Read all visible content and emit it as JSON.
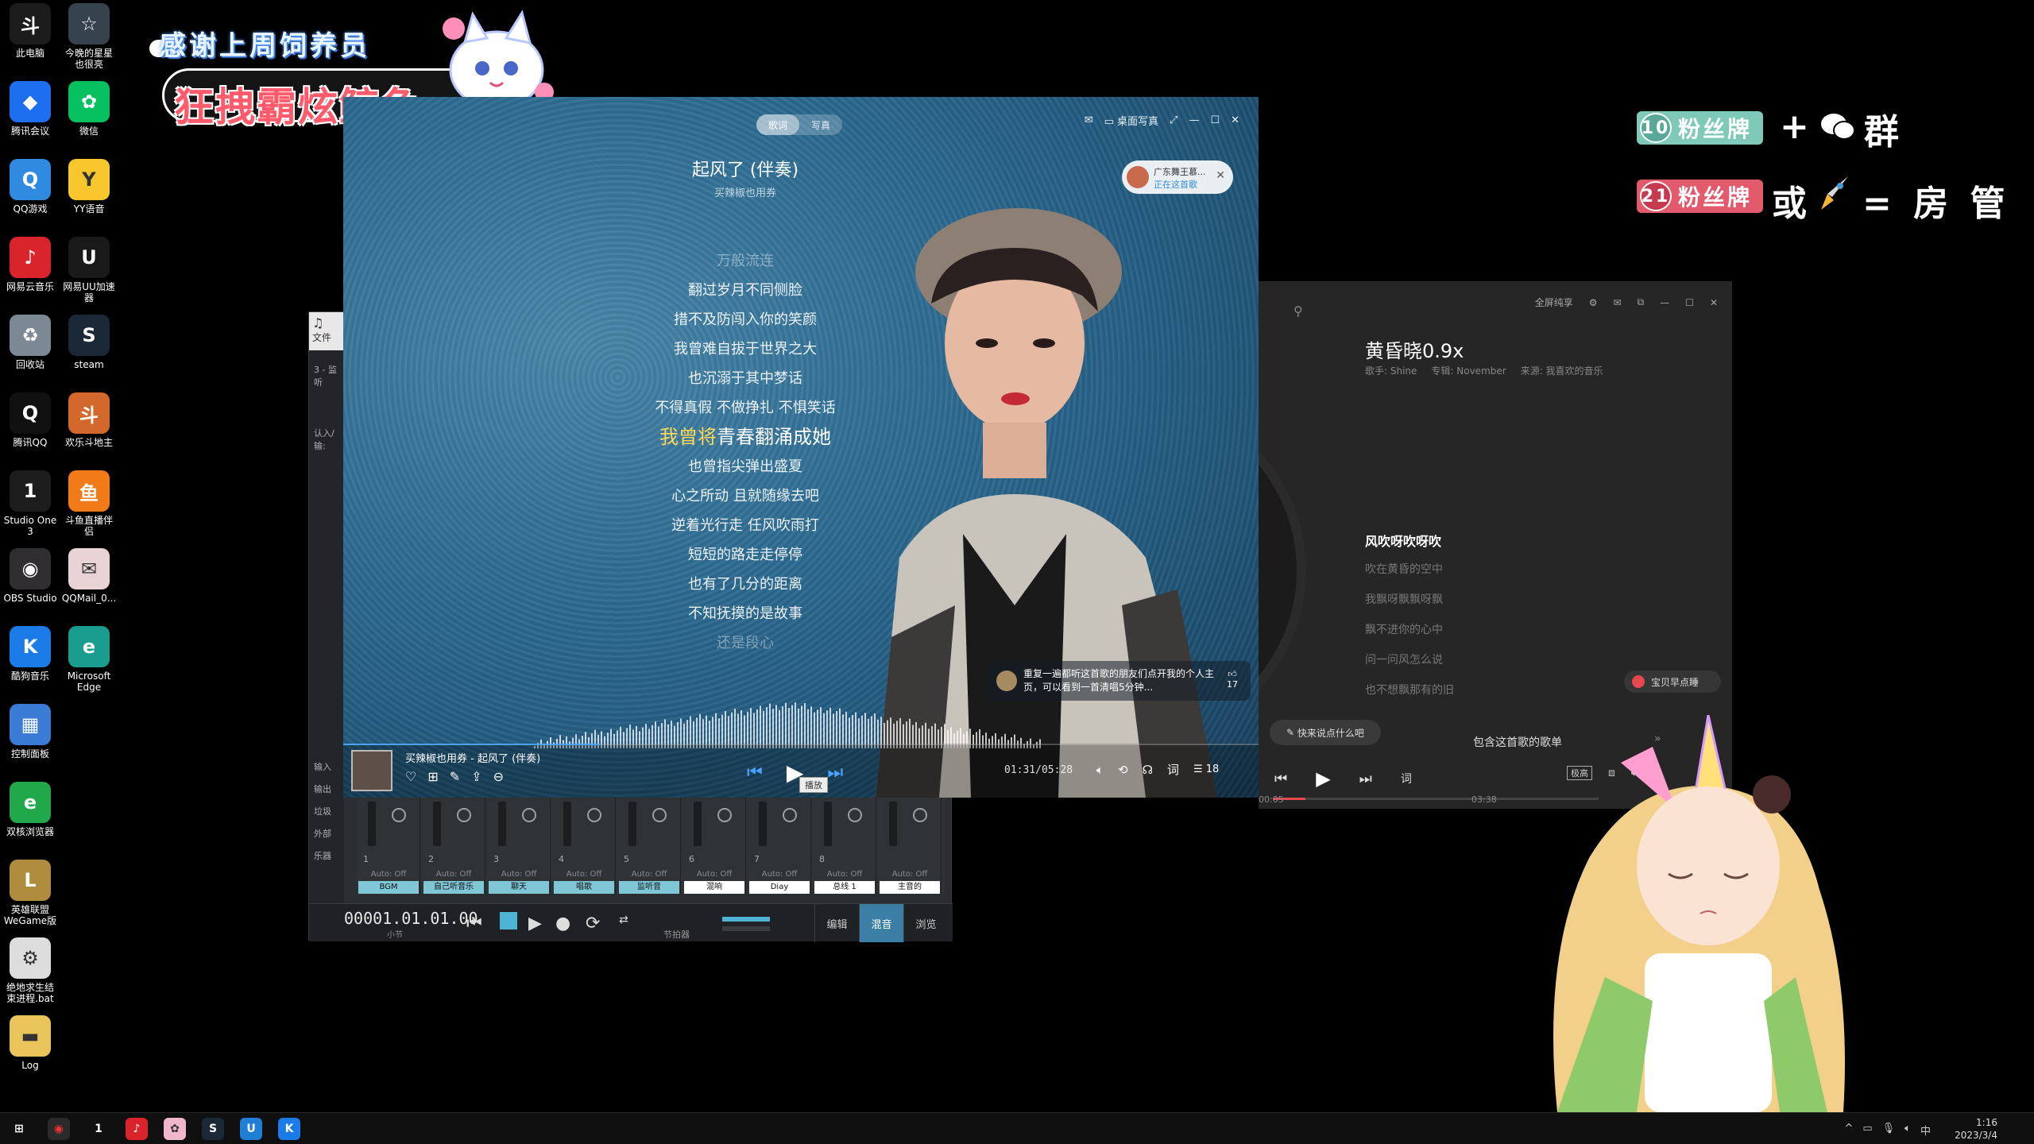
{
  "desktop": {
    "icons": [
      {
        "label": "此电脑",
        "glyph": "斗",
        "color": "#1c1c1c"
      },
      {
        "label": "今晚的星星\n也很亮",
        "glyph": "☆",
        "color": "#37424f"
      },
      {
        "label": "腾讯会议",
        "glyph": "◆",
        "color": "#1e6ef0"
      },
      {
        "label": "微信",
        "glyph": "✿",
        "color": "#07c160"
      },
      {
        "label": "QQ游戏",
        "glyph": "Q",
        "color": "#2f8bdf"
      },
      {
        "label": "YY语音",
        "glyph": "Y",
        "color": "#f7c52c"
      },
      {
        "label": "网易云音乐",
        "glyph": "♪",
        "color": "#d9242c"
      },
      {
        "label": "网易UU加速\n器",
        "glyph": "U",
        "color": "#1a1a1a"
      },
      {
        "label": "回收站",
        "glyph": "♻",
        "color": "#7c8894"
      },
      {
        "label": "steam",
        "glyph": "S",
        "color": "#1b2838"
      },
      {
        "label": "腾讯QQ",
        "glyph": "Q",
        "color": "#111111"
      },
      {
        "label": "欢乐斗地主",
        "glyph": "斗",
        "color": "#d2682b"
      },
      {
        "label": "Studio One\n3",
        "glyph": "1",
        "color": "#1d1d1d"
      },
      {
        "label": "斗鱼直播伴\n侣",
        "glyph": "鱼",
        "color": "#f07b18"
      },
      {
        "label": "OBS Studio",
        "glyph": "◉",
        "color": "#302e31"
      },
      {
        "label": "QQMail_0...",
        "glyph": "✉",
        "color": "#e9d3d7"
      },
      {
        "label": "酷狗音乐",
        "glyph": "K",
        "color": "#1b7ce8"
      },
      {
        "label": "Microsoft\nEdge",
        "glyph": "e",
        "color": "#1a9d8f"
      },
      {
        "label": "控制面板",
        "glyph": "▦",
        "color": "#3a7bd5"
      },
      {
        "label": "双核浏览器",
        "glyph": "e",
        "color": "#20a84b"
      },
      {
        "label": "英雄联盟\nWeGame版",
        "glyph": "L",
        "color": "#b08d3e"
      },
      {
        "label": "绝地求生结\n束进程.bat",
        "glyph": "⚙",
        "color": "#dddddd"
      },
      {
        "label": "Log",
        "glyph": "▬",
        "color": "#e8c45a"
      }
    ]
  },
  "overlay": {
    "thanks": "感谢上周饲养员",
    "search_banner": "狂拽霸炫鲸鱼",
    "badge10_num": "10",
    "badge10_label": "粉丝牌",
    "badge21_num": "21",
    "badge21_label": "粉丝牌",
    "plus_group": "群",
    "or_text": "或",
    "equals_text": "= 房 管"
  },
  "daw": {
    "tab_label": "文件",
    "side_items": [
      "3 - 监听",
      "认入/输:",
      "输入",
      "输出",
      "垃圾",
      "外部",
      "乐器"
    ],
    "channels": [
      {
        "num": "1",
        "auto": "Auto: Off",
        "name": "BGM",
        "color": "#7fc6d6"
      },
      {
        "num": "2",
        "auto": "Auto: Off",
        "name": "自己听音乐",
        "color": "#7fc6d6"
      },
      {
        "num": "3",
        "auto": "Auto: Off",
        "name": "聊天",
        "color": "#7fc6d6"
      },
      {
        "num": "4",
        "auto": "Auto: Off",
        "name": "唱歌",
        "color": "#7fc6d6"
      },
      {
        "num": "5",
        "auto": "Auto: Off",
        "name": "监听音",
        "color": "#7fc6d6"
      },
      {
        "num": "6",
        "auto": "Auto: Off",
        "name": "混响",
        "color": "#ffffff"
      },
      {
        "num": "7",
        "auto": "Auto: Off",
        "name": "Diay",
        "color": "#ffffff"
      },
      {
        "num": "8",
        "auto": "Auto: Off",
        "name": "总线 1",
        "color": "#ffffff"
      },
      {
        "num": "",
        "auto": "Auto: Off",
        "name": "主音的",
        "color": "#ffffff"
      }
    ],
    "time": "00001.01.01.00",
    "time_sub": "小节",
    "metronome": "节拍器",
    "mode_edit": "编辑",
    "mode_mix": "混音",
    "mode_browse": "浏览"
  },
  "player": {
    "tab_lyrics": "歌词",
    "tab_photo": "写真",
    "desktop_lyrics": "桌面写真",
    "title": "起风了 (伴奏)",
    "artist": "买辣椒也用券",
    "live_name": "广东舞王慕...",
    "live_status": "正在这首歌",
    "lyrics_before": [
      "万般流连",
      "翻过岁月不同侧脸",
      "措不及防闯入你的笑颜",
      "我曾难自拔于世界之大",
      "也沉溺于其中梦话",
      "不得真假 不做挣扎 不惧笑话"
    ],
    "current_sung": "我曾将",
    "current_rest": "青春翻涌成她",
    "lyrics_after": [
      "也曾指尖弹出盛夏",
      "心之所动 且就随缘去吧",
      "逆着光行走 任风吹雨打",
      "短短的路走走停停",
      "也有了几分的距离",
      "不知抚摸的是故事",
      "还是段心"
    ],
    "comment_text": "重复一遍都听这首歌的朋友们点开我的个人主页，可以看到一首清唱5分钟...",
    "comment_likes": "17",
    "now_playing": "买辣椒也用券 - 起风了 (伴奏)",
    "tooltip": "播放",
    "time": "01:31/05:28",
    "progress": 0.28,
    "playlist_count": "18"
  },
  "dark_player": {
    "fullscreen_pure": "全屏纯享",
    "title": "黄昏晓0.9x",
    "singer": "歌手: Shine",
    "album": "专辑: November",
    "source": "来源: 我喜欢的音乐",
    "lyrics": [
      "风吹呀吹呀吹",
      "吹在黄昏的空中",
      "我飘呀飘飘呀飘",
      "飘不进你的心中",
      "问一问风怎么说",
      "也不想飘那有的旧"
    ],
    "say_something": "快来说点什么吧",
    "includes_playlist": "包含这首歌的歌单",
    "friend_pill": "宝贝早点睡",
    "time_start": "00:05",
    "time_end": "03:38",
    "progress": 0.1,
    "quality": "极高",
    "lyric_btn": "词"
  },
  "taskbar": {
    "time": "1:16",
    "date": "2023/3/4",
    "ime": "中"
  }
}
